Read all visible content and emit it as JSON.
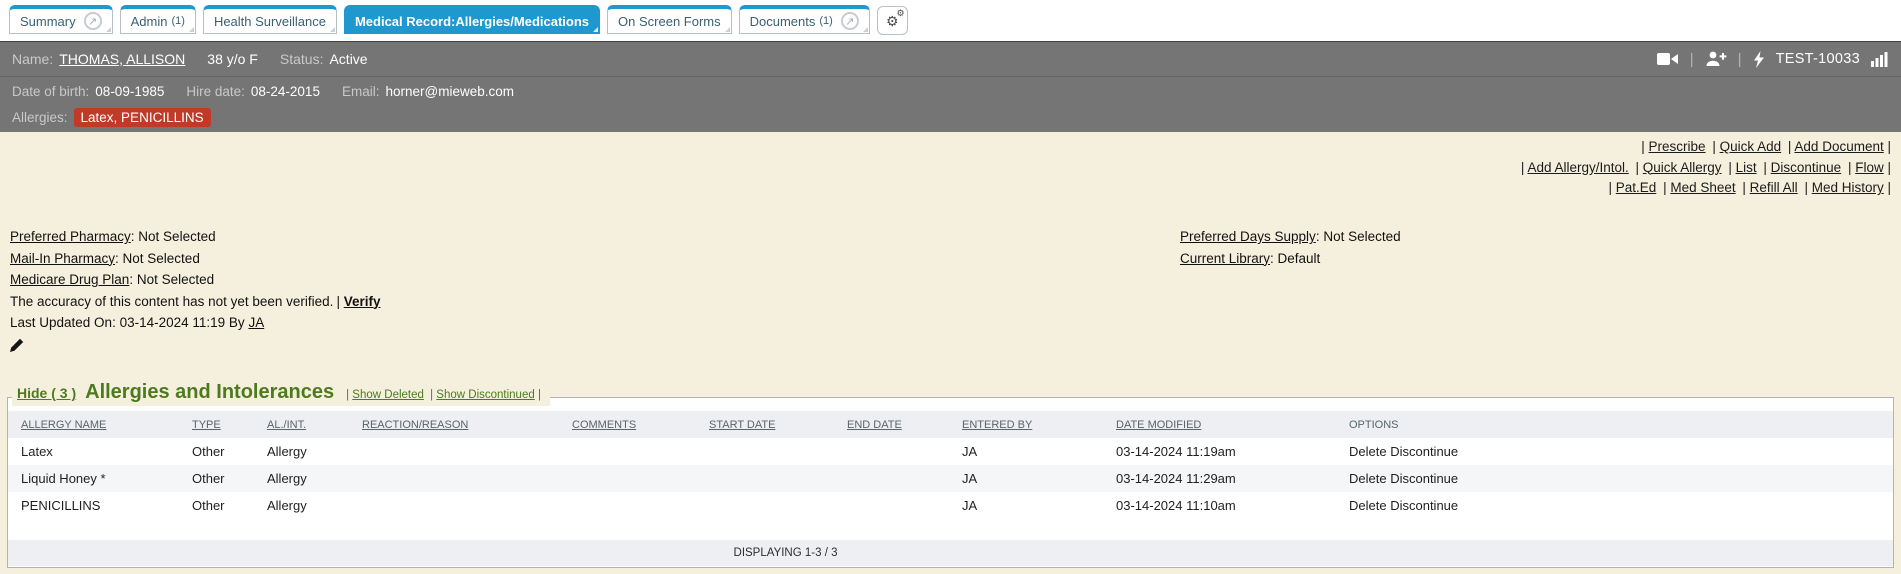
{
  "colors": {
    "tab_accent": "#1f98d0",
    "header_bar": "#757575",
    "allergy_badge": "#bf3a27",
    "section_green": "#4d7a1f",
    "page_background": "#f5f0dd",
    "table_header_bg": "#edeff2"
  },
  "tabs": {
    "items": [
      {
        "label": "Summary",
        "count": ""
      },
      {
        "label": "Admin",
        "count": "(1)"
      },
      {
        "label": "Health Surveillance",
        "count": ""
      },
      {
        "label": "Medical Record:Allergies/Medications",
        "count": ""
      },
      {
        "label": "On Screen Forms",
        "count": ""
      },
      {
        "label": "Documents",
        "count": "(1)"
      }
    ]
  },
  "patient": {
    "name_label": "Name:",
    "name": "THOMAS, ALLISON",
    "age_sex": "38 y/o F",
    "status_label": "Status:",
    "status": "Active",
    "dob_label": "Date of birth:",
    "dob": "08-09-1985",
    "hire_label": "Hire date:",
    "hire": "08-24-2015",
    "email_label": "Email:",
    "email": "horner@mieweb.com",
    "allergies_label": "Allergies:",
    "allergies_badge": "Latex, PENICILLINS",
    "chart_id": "TEST-10033"
  },
  "icons": [
    "popout-icon",
    "gears-icon",
    "video-camera-icon",
    "person-add-icon",
    "lightning-icon",
    "bar-chart-icon",
    "pencil-icon"
  ],
  "actions": {
    "row1": [
      "Prescribe",
      "Quick Add",
      "Add Document"
    ],
    "row2": [
      "Add Allergy/Intol.",
      "Quick Allergy",
      "List",
      "Discontinue",
      "Flow"
    ],
    "row3": [
      "Pat.Ed",
      "Med Sheet",
      "Refill All",
      "Med History"
    ]
  },
  "rx_info": {
    "preferred_label": "Preferred Pharmacy",
    "preferred_value": ": Not Selected",
    "mailin_label": "Mail-In Pharmacy",
    "mailin_value": ": Not Selected",
    "medicare_label": "Medicare Drug Plan",
    "medicare_value": ": Not Selected",
    "accuracy_text": "The accuracy of this content has not yet been verified.",
    "verify_label": "Verify",
    "last_updated_text": "Last Updated On: 03-14-2024 11:19 By",
    "updated_by": "JA",
    "days_supply_label": "Preferred Days Supply",
    "days_supply_value": ": Not Selected",
    "library_label": "Current Library",
    "library_value": ": Default"
  },
  "allergy_section": {
    "hide_label": "Hide ( 3 )",
    "title": "Allergies and Intolerances",
    "show_deleted": "Show Deleted",
    "show_discontinued": "Show Discontinued",
    "columns": [
      "ALLERGY NAME",
      "TYPE",
      "AL./INT.",
      "REACTION/REASON",
      "COMMENTS",
      "START DATE",
      "END DATE",
      "ENTERED BY",
      "DATE MODIFIED",
      "OPTIONS"
    ],
    "option_labels": {
      "delete": "Delete",
      "discontinue": "Discontinue"
    },
    "rows": [
      {
        "allergy_name": "Latex",
        "type": "Other",
        "al_int": "Allergy",
        "reaction": "",
        "comments": "",
        "start_date": "",
        "end_date": "",
        "entered_by": "JA",
        "date_modified": "03-14-2024 11:19am"
      },
      {
        "allergy_name": "Liquid Honey *",
        "type": "Other",
        "al_int": "Allergy",
        "reaction": "",
        "comments": "",
        "start_date": "",
        "end_date": "",
        "entered_by": "JA",
        "date_modified": "03-14-2024 11:29am"
      },
      {
        "allergy_name": "PENICILLINS",
        "type": "Other",
        "al_int": "Allergy",
        "reaction": "",
        "comments": "",
        "start_date": "",
        "end_date": "",
        "entered_by": "JA",
        "date_modified": "03-14-2024 11:10am"
      }
    ],
    "footer": "DISPLAYING 1-3 / 3"
  }
}
